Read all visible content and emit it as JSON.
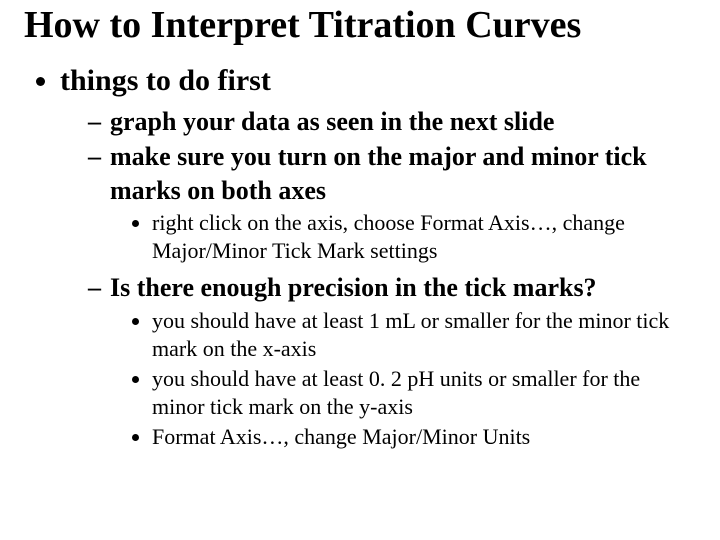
{
  "title": "How to Interpret Titration Curves",
  "bullets": {
    "l1": {
      "item1": "things to do first"
    },
    "l2": {
      "a": "graph your data as seen in the next slide",
      "b": "make sure you turn on the major and minor tick marks on both axes",
      "c": "Is there enough precision in the tick marks?"
    },
    "l3": {
      "b1": "right click on the axis, choose Format Axis…, change Major/Minor Tick Mark settings",
      "c1": "you should have at least 1 mL or smaller for the minor tick mark on the x-axis",
      "c2": "you should have at least 0. 2 pH units or smaller for the minor tick mark on the y-axis",
      "c3": "Format Axis…, change Major/Minor Units"
    }
  }
}
